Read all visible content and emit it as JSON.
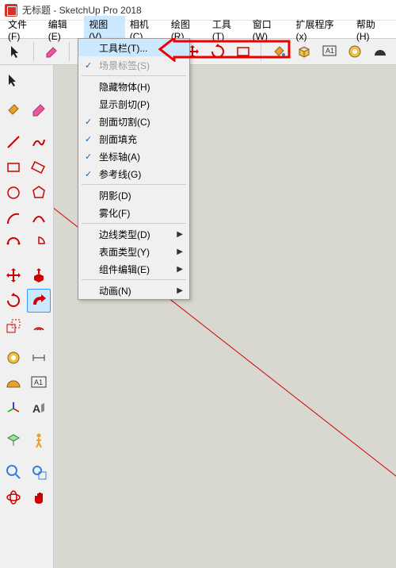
{
  "title": "无标题 - SketchUp Pro 2018",
  "menubar": [
    "文件(F)",
    "编辑(E)",
    "视图(V)",
    "相机(C)",
    "绘图(R)",
    "工具(T)",
    "窗口(W)",
    "扩展程序 (x)",
    "帮助(H)"
  ],
  "active_menu_index": 2,
  "dropdown": {
    "groups": [
      [
        {
          "label": "工具栏(T)...",
          "checked": false,
          "highlight": true
        },
        {
          "label": "场景标签(S)",
          "checked": true,
          "disabled": true
        }
      ],
      [
        {
          "label": "隐藏物体(H)",
          "checked": false
        },
        {
          "label": "显示剖切(P)",
          "checked": false
        },
        {
          "label": "剖面切割(C)",
          "checked": true
        },
        {
          "label": "剖面填充",
          "checked": true
        },
        {
          "label": "坐标轴(A)",
          "checked": true
        },
        {
          "label": "参考线(G)",
          "checked": true
        }
      ],
      [
        {
          "label": "阴影(D)",
          "checked": false
        },
        {
          "label": "雾化(F)",
          "checked": false
        }
      ],
      [
        {
          "label": "边线类型(D)",
          "submenu": true
        },
        {
          "label": "表面类型(Y)",
          "submenu": true
        },
        {
          "label": "组件编辑(E)",
          "submenu": true
        }
      ],
      [
        {
          "label": "动画(N)",
          "submenu": true
        }
      ]
    ]
  }
}
